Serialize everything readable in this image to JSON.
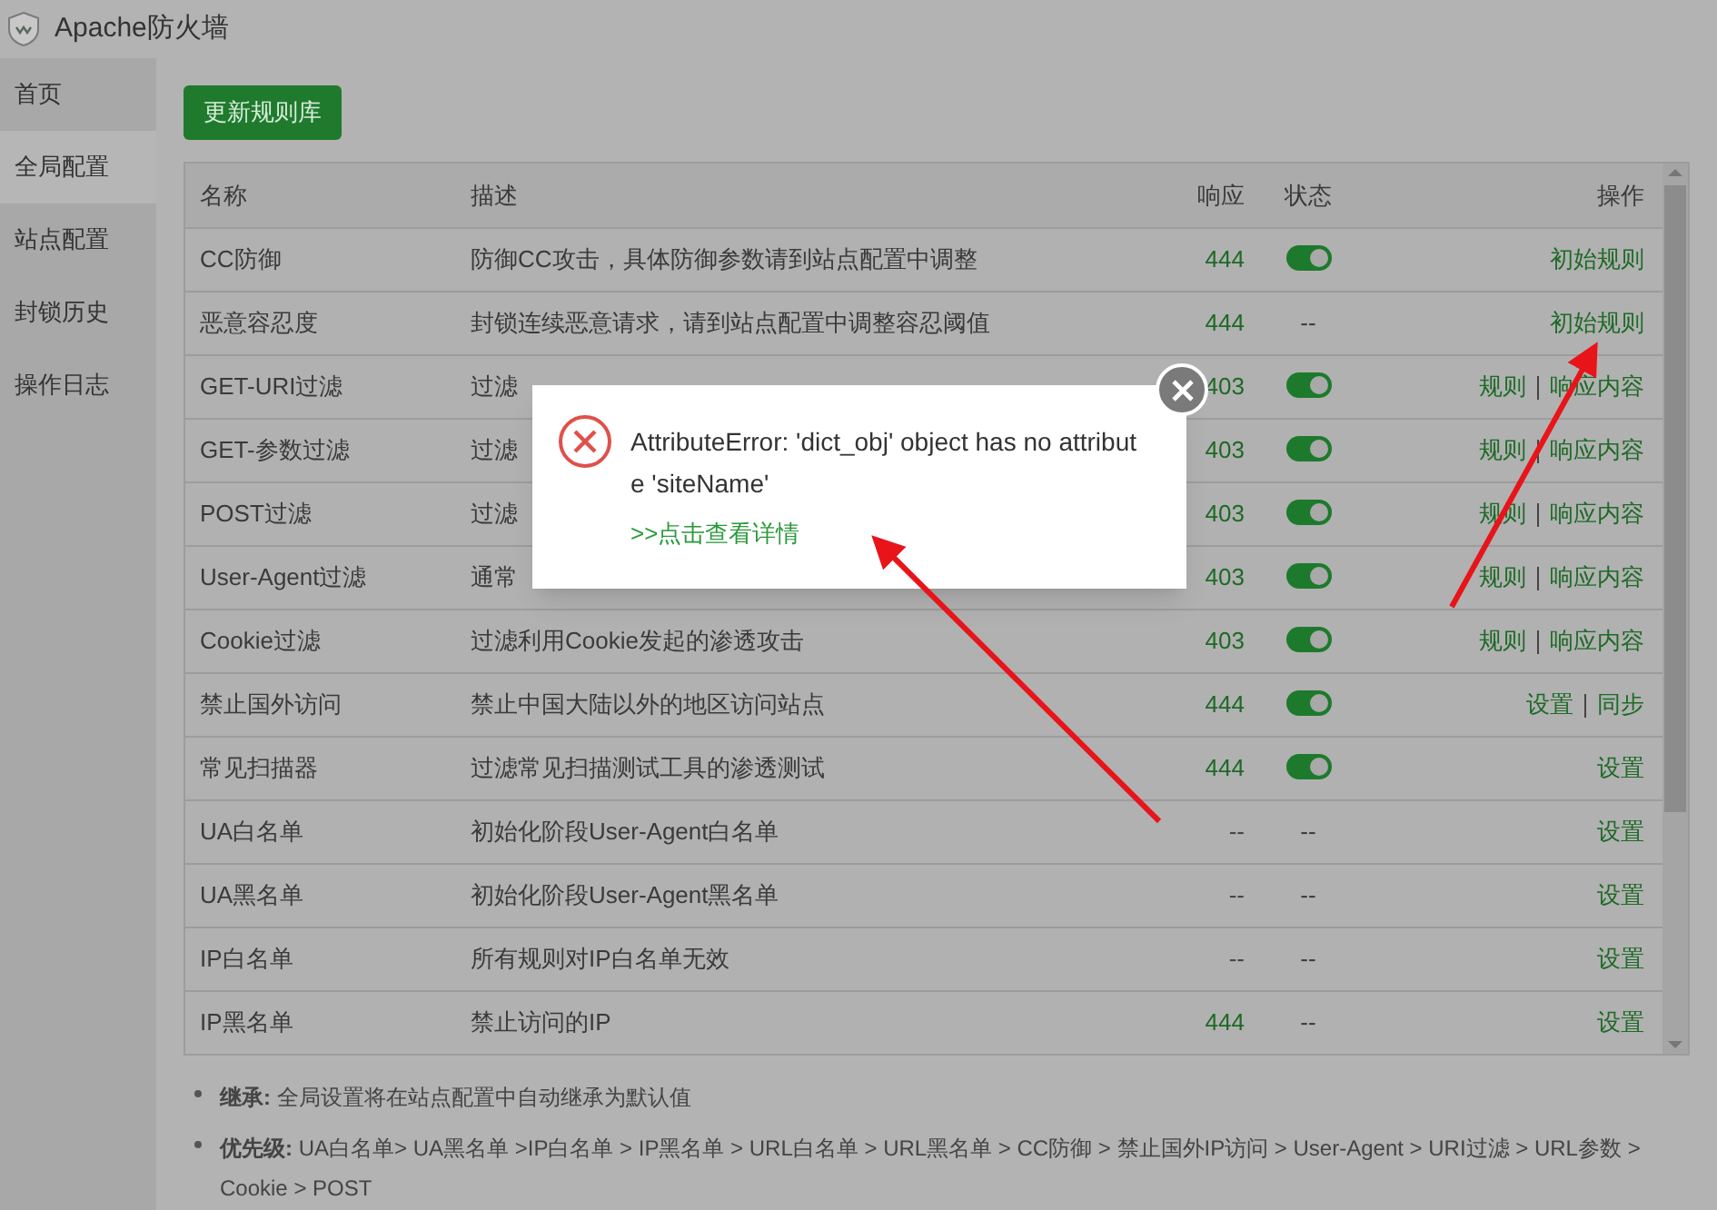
{
  "window": {
    "title": "Apache防火墙"
  },
  "sidebar": {
    "items": [
      {
        "label": "首页",
        "selected": false
      },
      {
        "label": "全局配置",
        "selected": true
      },
      {
        "label": "站点配置",
        "selected": false
      },
      {
        "label": "封锁历史",
        "selected": false
      },
      {
        "label": "操作日志",
        "selected": false
      }
    ]
  },
  "update_button": "更新规则库",
  "table": {
    "columns": [
      "名称",
      "描述",
      "响应",
      "状态",
      "操作"
    ],
    "rows": [
      {
        "name": "CC防御",
        "description": "防御CC攻击，具体防御参数请到站点配置中调整",
        "response": "444",
        "status": {
          "kind": "switch",
          "on": true
        },
        "actions": [
          "初始规则"
        ]
      },
      {
        "name": "恶意容忍度",
        "description": "封锁连续恶意请求，请到站点配置中调整容忍阈值",
        "response": "444",
        "status": {
          "kind": "text",
          "text": "--"
        },
        "actions": [
          "初始规则"
        ]
      },
      {
        "name": "GET-URI过滤",
        "description": "过滤",
        "response": "403",
        "status": {
          "kind": "switch",
          "on": true
        },
        "actions": [
          "规则",
          "响应内容"
        ]
      },
      {
        "name": "GET-参数过滤",
        "description": "过滤",
        "response": "403",
        "status": {
          "kind": "switch",
          "on": true
        },
        "actions": [
          "规则",
          "响应内容"
        ]
      },
      {
        "name": "POST过滤",
        "description": "过滤",
        "response": "403",
        "status": {
          "kind": "switch",
          "on": true
        },
        "actions": [
          "规则",
          "响应内容"
        ]
      },
      {
        "name": "User-Agent过滤",
        "description": "通常",
        "response": "403",
        "status": {
          "kind": "switch",
          "on": true
        },
        "actions": [
          "规则",
          "响应内容"
        ]
      },
      {
        "name": "Cookie过滤",
        "description": "过滤利用Cookie发起的渗透攻击",
        "response": "403",
        "status": {
          "kind": "switch",
          "on": true
        },
        "actions": [
          "规则",
          "响应内容"
        ]
      },
      {
        "name": "禁止国外访问",
        "description": "禁止中国大陆以外的地区访问站点",
        "response": "444",
        "status": {
          "kind": "switch",
          "on": true
        },
        "actions": [
          "设置",
          "同步"
        ]
      },
      {
        "name": "常见扫描器",
        "description": "过滤常见扫描测试工具的渗透测试",
        "response": "444",
        "status": {
          "kind": "switch",
          "on": true
        },
        "actions": [
          "设置"
        ]
      },
      {
        "name": "UA白名单",
        "description": "初始化阶段User-Agent白名单",
        "response": "--",
        "status": {
          "kind": "text",
          "text": "--"
        },
        "actions": [
          "设置"
        ]
      },
      {
        "name": "UA黑名单",
        "description": "初始化阶段User-Agent黑名单",
        "response": "--",
        "status": {
          "kind": "text",
          "text": "--"
        },
        "actions": [
          "设置"
        ]
      },
      {
        "name": "IP白名单",
        "description": "所有规则对IP白名单无效",
        "response": "--",
        "status": {
          "kind": "text",
          "text": "--"
        },
        "actions": [
          "设置"
        ]
      },
      {
        "name": "IP黑名单",
        "description": "禁止访问的IP",
        "response": "444",
        "status": {
          "kind": "text",
          "text": "--"
        },
        "actions": [
          "设置"
        ]
      }
    ]
  },
  "notes": [
    "**继承:** 全局设置将在站点配置中自动继承为默认值",
    "**优先级:** UA白名单> UA黑名单 >IP白名单 > IP黑名单 > URL白名单 > URL黑名单 > CC防御 > 禁止国外IP访问 > User-Agent > URI过滤 > URL参数 > Cookie > POST"
  ],
  "error_dialog": {
    "message": "AttributeError: 'dict_obj' object has no attribute 'siteName'",
    "link": ">>点击查看详情"
  }
}
